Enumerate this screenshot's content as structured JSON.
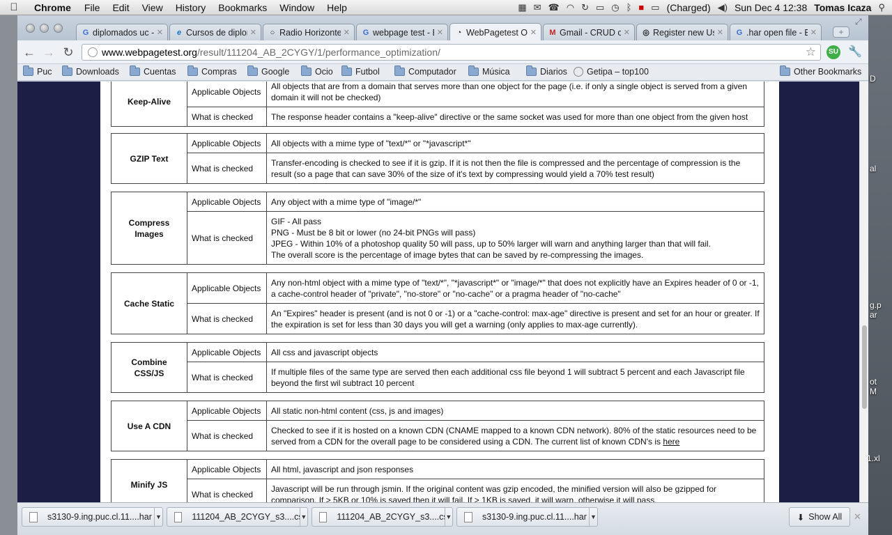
{
  "menubar": {
    "app": "Chrome",
    "menus": [
      "File",
      "Edit",
      "View",
      "History",
      "Bookmarks",
      "Window",
      "Help"
    ],
    "battery": "(Charged)",
    "datetime": "Sun Dec 4  12:38",
    "user": "Tomas Icaza"
  },
  "tabs": [
    {
      "title": "diplomados uc -",
      "favicon": "G"
    },
    {
      "title": "Cursos de diplom",
      "favicon": "e"
    },
    {
      "title": "Radio Horizonte",
      "favicon": "○"
    },
    {
      "title": "webpage test - B",
      "favicon": "G"
    },
    {
      "title": "WebPagetest Op",
      "favicon": "◔"
    },
    {
      "title": "Gmail - CRUD co",
      "favicon": "M"
    },
    {
      "title": "Register new Use",
      "favicon": "◎"
    },
    {
      "title": ".har open file - B",
      "favicon": "G"
    }
  ],
  "omnibox": {
    "host": "www.webpagetest.org",
    "path": "/result/111204_AB_2CYGY/1/performance_optimization/"
  },
  "bookmarks": [
    "Puc",
    "Downloads",
    "Cuentas",
    "Compras",
    "Google",
    "Ocio",
    "Futbol",
    "Computador",
    "Música",
    "Diarios",
    "Getipa – top100"
  ],
  "other_bookmarks": "Other Bookmarks",
  "desktop_labels": [
    "D",
    "al",
    "g.p",
    "ar",
    "ot",
    "M",
    "1.xl"
  ],
  "rules": [
    {
      "name": "Keep-Alive",
      "rows": [
        {
          "label": "Applicable Objects",
          "lines": [
            "All objects that are from a domain that serves more than one object for the page (i.e. if only a single object is served from a given domain it will not be checked)"
          ]
        },
        {
          "label": "What is checked",
          "lines": [
            "The response header contains a \"keep-alive\" directive or the same socket was used for more than one object from the given host"
          ]
        }
      ]
    },
    {
      "name": "GZIP Text",
      "rows": [
        {
          "label": "Applicable Objects",
          "lines": [
            "All objects with a mime type of \"text/*\" or \"*javascript*\""
          ]
        },
        {
          "label": "What is checked",
          "lines": [
            "Transfer-encoding is checked to see if it is gzip. If it is not then the file is compressed and the percentage of compression is the result (so a page that can save 30% of the size of it's text by compressing would yield a 70% test result)"
          ]
        }
      ]
    },
    {
      "name": "Compress Images",
      "rows": [
        {
          "label": "Applicable Objects",
          "lines": [
            "Any object with a mime type of \"image/*\""
          ]
        },
        {
          "label": "What is checked",
          "lines": [
            "GIF - All pass",
            "PNG - Must be 8 bit or lower (no 24-bit PNGs will pass)",
            "JPEG - Within 10% of a photoshop quality 50 will pass, up to 50% larger will warn and anything larger than that will fail.",
            "The overall score is the percentage of image bytes that can be saved by re-compressing the images."
          ]
        }
      ]
    },
    {
      "name": "Cache Static",
      "rows": [
        {
          "label": "Applicable Objects",
          "lines": [
            "Any non-html object with a mime type of \"text/*\", \"*javascript*\" or \"image/*\" that does not explicitly have an Expires header of 0 or -1, a cache-control header of \"private\", \"no-store\" or \"no-cache\" or a pragma header of \"no-cache\""
          ]
        },
        {
          "label": "What is checked",
          "lines": [
            "An \"Expires\" header is present (and is not 0 or -1) or a \"cache-control: max-age\" directive is present and set for an hour or greater. If the expiration is set for less than 30 days you will get a warning (only applies to max-age currently)."
          ]
        }
      ]
    },
    {
      "name": "Combine CSS/JS",
      "rows": [
        {
          "label": "Applicable Objects",
          "lines": [
            "All css and javascript objects"
          ]
        },
        {
          "label": "What is checked",
          "lines": [
            "If multiple files of the same type are served then each additional css file beyond 1 will subtract 5 percent and each Javascript file beyond the first wil subtract 10 percent"
          ]
        }
      ]
    },
    {
      "name": "Use A CDN",
      "rows": [
        {
          "label": "Applicable Objects",
          "lines": [
            "All static non-html content (css, js and images)"
          ]
        },
        {
          "label": "What is checked",
          "lines": [
            "Checked to see if it is hosted on a known CDN (CNAME mapped to a known CDN network). 80% of the static resources need to be served from a CDN for the overall page to be considered using a CDN. The current list of known CDN's is"
          ],
          "link": "here"
        }
      ]
    },
    {
      "name": "Minify JS",
      "rows": [
        {
          "label": "Applicable Objects",
          "lines": [
            "All html, javascript and json responses"
          ]
        },
        {
          "label": "What is checked",
          "lines": [
            "Javascript will be run through jsmin. If the original content was gzip encoded, the minified version will also be gzipped for comparison. If > 5KB or 10% is saved then it will fail. If > 1KB is saved, it will warn, otherwise it will pass."
          ]
        }
      ]
    }
  ],
  "downloads": [
    "s3130-9.ing.puc.cl.11....har",
    "111204_AB_2CYGY_s3....csv",
    "111204_AB_2CYGY_s3....csv",
    "s3130-9.ing.puc.cl.11....har"
  ],
  "show_all": "Show All"
}
